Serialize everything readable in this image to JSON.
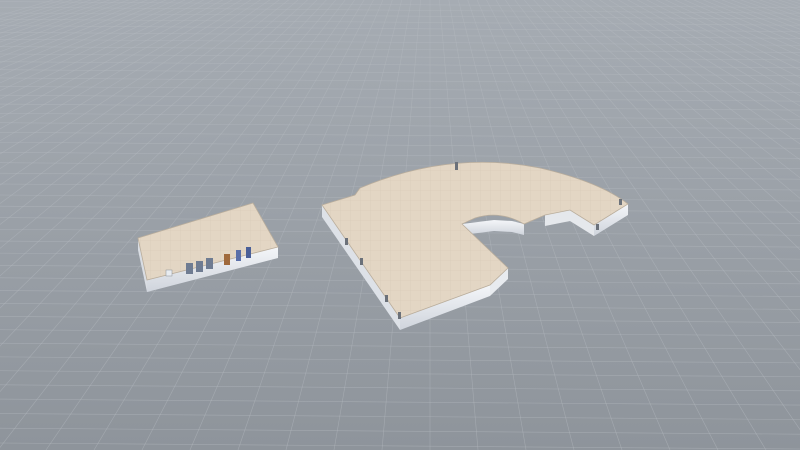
{
  "scene": {
    "type": "3d-floor-plan-viewer",
    "view": "perspective",
    "ground_grid": true,
    "background_color": "#9aa0a8",
    "objects": [
      {
        "name": "small-rectangular-building",
        "kind": "building-model",
        "has_doors": true
      },
      {
        "name": "large-curved-building",
        "kind": "building-model",
        "has_doors": true
      }
    ]
  },
  "colors": {
    "sky": "#a3a9b1",
    "ground": "#8f959d",
    "grid_line": "#b5bac0",
    "floor_top": "#e3d6c4",
    "floor_tile": "#d3c6b4",
    "wall": "#f1f3f6",
    "wall_shade": "#c7ccd4",
    "door_blue": "#5a6fa8",
    "door_brown": "#a06a3c",
    "edge": "#8a8f96"
  }
}
